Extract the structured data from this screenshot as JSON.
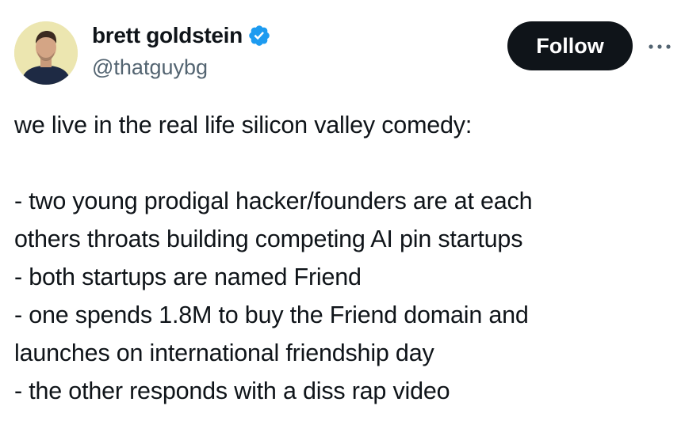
{
  "author": {
    "display_name": "brett goldstein",
    "handle": "@thatguybg",
    "verified": true,
    "avatar_icon": "avatar-photo"
  },
  "actions": {
    "follow_label": "Follow",
    "more_icon": "more-horizontal-icon"
  },
  "tweet": {
    "lines": [
      "we live in the real life silicon valley comedy:",
      "",
      "- two young prodigal hacker/founders are at each",
      "others throats building competing AI pin startups",
      "- both startups are named Friend",
      "- one spends 1.8M to buy the Friend domain and",
      "launches on international friendship day",
      "- the other responds with a diss rap video"
    ]
  },
  "colors": {
    "text": "#0f1419",
    "secondary": "#536471",
    "button_bg": "#0f1419",
    "verified_blue": "#1d9bf0"
  }
}
